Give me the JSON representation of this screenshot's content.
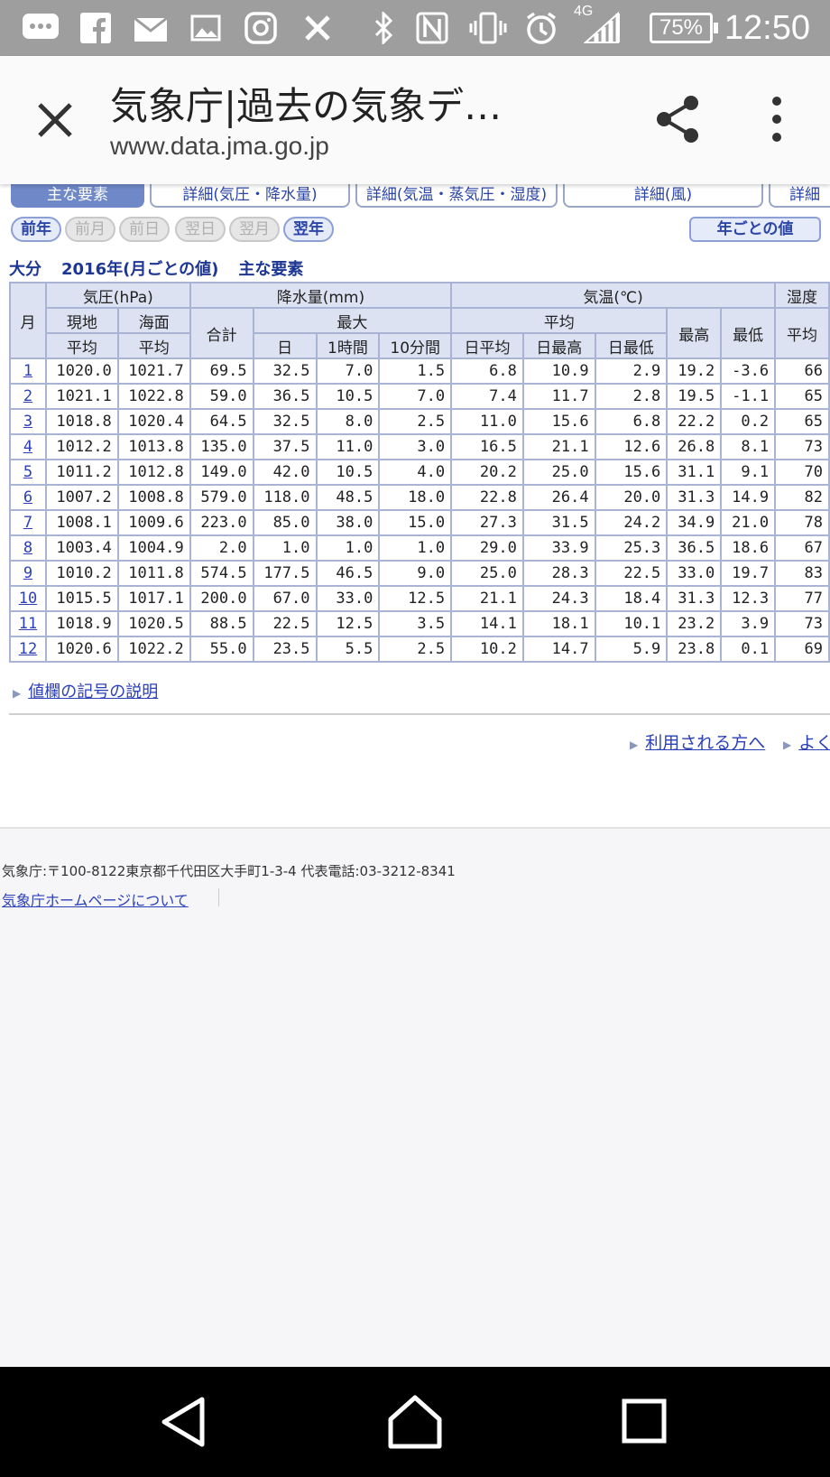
{
  "status_bar": {
    "network": "4G",
    "battery": "75%",
    "time": "12:50"
  },
  "browser": {
    "title": "気象庁|過去の気象デ…",
    "url": "www.data.jma.go.jp"
  },
  "tabs": [
    {
      "label": "主な要素",
      "active": true
    },
    {
      "label": "詳細(気圧・降水量)",
      "active": false
    },
    {
      "label": "詳細(気温・蒸気圧・湿度)",
      "active": false
    },
    {
      "label": "詳細(風)",
      "active": false
    },
    {
      "label": "詳細",
      "active": false
    }
  ],
  "nav": {
    "prev_year": "前年",
    "prev_month": "前月",
    "prev_day": "前日",
    "next_day": "翌日",
    "next_month": "翌月",
    "next_year": "翌年",
    "yearly": "年ごとの値"
  },
  "caption": {
    "place": "大分",
    "period": "2016年(月ごとの値)",
    "element": "主な要素"
  },
  "table": {
    "headers": {
      "month": "月",
      "pressure": "気圧(hPa)",
      "station": "現地",
      "sea": "海面",
      "avg1": "平均",
      "avg2": "平均",
      "precip": "降水量(mm)",
      "total": "合計",
      "max": "最大",
      "day": "日",
      "hour": "1時間",
      "min10": "10分間",
      "temp": "気温(℃)",
      "temp_avg": "平均",
      "daily_avg": "日平均",
      "daily_max": "日最高",
      "daily_min": "日最低",
      "highest": "最高",
      "lowest": "最低",
      "humidity": "湿度",
      "hum_avg": "平均"
    },
    "rows": [
      [
        "1",
        "1020.0",
        "1021.7",
        "69.5",
        "32.5",
        "7.0",
        "1.5",
        "6.8",
        "10.9",
        "2.9",
        "19.2",
        "-3.6",
        "66"
      ],
      [
        "2",
        "1021.1",
        "1022.8",
        "59.0",
        "36.5",
        "10.5",
        "7.0",
        "7.4",
        "11.7",
        "2.8",
        "19.5",
        "-1.1",
        "65"
      ],
      [
        "3",
        "1018.8",
        "1020.4",
        "64.5",
        "32.5",
        "8.0",
        "2.5",
        "11.0",
        "15.6",
        "6.8",
        "22.2",
        "0.2",
        "65"
      ],
      [
        "4",
        "1012.2",
        "1013.8",
        "135.0",
        "37.5",
        "11.0",
        "3.0",
        "16.5",
        "21.1",
        "12.6",
        "26.8",
        "8.1",
        "73"
      ],
      [
        "5",
        "1011.2",
        "1012.8",
        "149.0",
        "42.0",
        "10.5",
        "4.0",
        "20.2",
        "25.0",
        "15.6",
        "31.1",
        "9.1",
        "70"
      ],
      [
        "6",
        "1007.2",
        "1008.8",
        "579.0",
        "118.0",
        "48.5",
        "18.0",
        "22.8",
        "26.4",
        "20.0",
        "31.3",
        "14.9",
        "82"
      ],
      [
        "7",
        "1008.1",
        "1009.6",
        "223.0",
        "85.0",
        "38.0",
        "15.0",
        "27.3",
        "31.5",
        "24.2",
        "34.9",
        "21.0",
        "78"
      ],
      [
        "8",
        "1003.4",
        "1004.9",
        "2.0",
        "1.0",
        "1.0",
        "1.0",
        "29.0",
        "33.9",
        "25.3",
        "36.5",
        "18.6",
        "67"
      ],
      [
        "9",
        "1010.2",
        "1011.8",
        "574.5",
        "177.5",
        "46.5",
        "9.0",
        "25.0",
        "28.3",
        "22.5",
        "33.0",
        "19.7",
        "83"
      ],
      [
        "10",
        "1015.5",
        "1017.1",
        "200.0",
        "67.0",
        "33.0",
        "12.5",
        "21.1",
        "24.3",
        "18.4",
        "31.3",
        "12.3",
        "77"
      ],
      [
        "11",
        "1018.9",
        "1020.5",
        "88.5",
        "22.5",
        "12.5",
        "3.5",
        "14.1",
        "18.1",
        "10.1",
        "23.2",
        "3.9",
        "73"
      ],
      [
        "12",
        "1020.6",
        "1022.2",
        "55.0",
        "23.5",
        "5.5",
        "2.5",
        "10.2",
        "14.7",
        "5.9",
        "23.8",
        "0.1",
        "69"
      ]
    ]
  },
  "links": {
    "legend": "値欄の記号の説明",
    "users": "利用される方へ",
    "faq": "よく"
  },
  "footer": {
    "address": "気象庁:〒100-8122東京都千代田区大手町1-3-4 代表電話:03-3212-8341",
    "about": "気象庁ホームページについて"
  },
  "colors": {
    "accent": "#2b3fb8",
    "table_header": "#dce2f2",
    "table_border": "#a9b4d4",
    "status_bar": "#9e9e9e"
  }
}
